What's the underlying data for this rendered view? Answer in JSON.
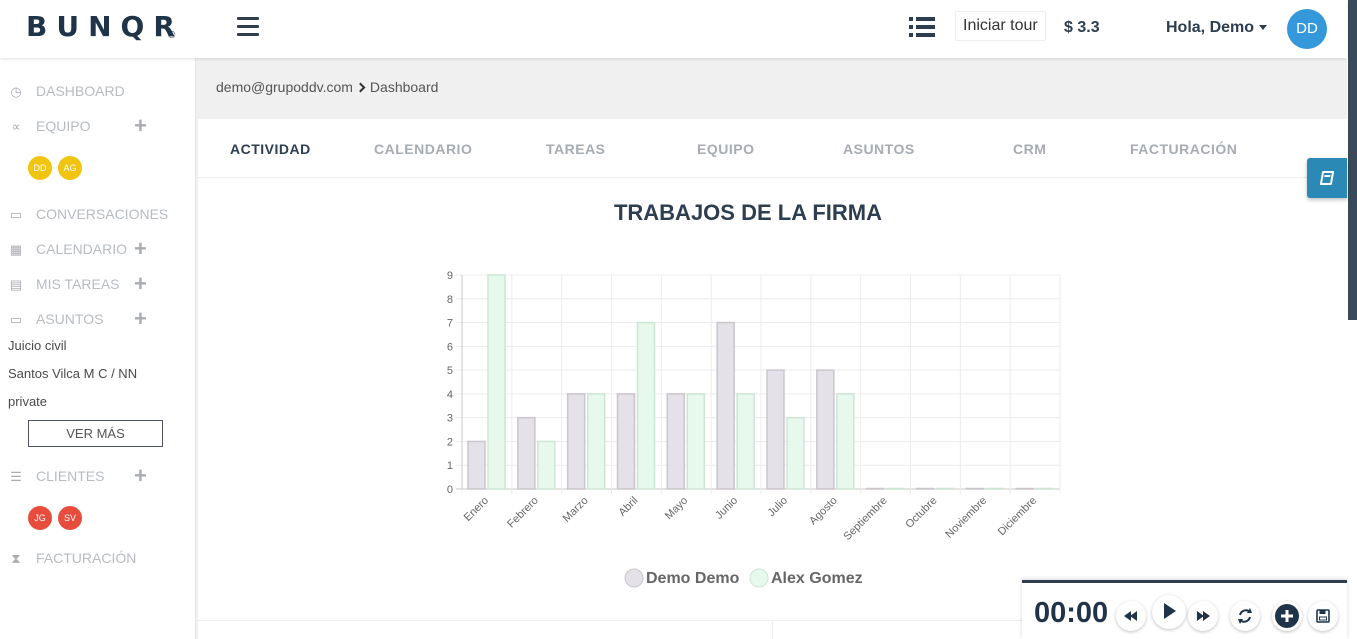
{
  "brand": {
    "name": "BUNQR",
    "registered": "®"
  },
  "topbar": {
    "tour_label": "Iniciar tour",
    "balance": "$ 3.3",
    "greeting": "Hola, Demo",
    "avatar_initials": "DD"
  },
  "sidebar": {
    "dashboard": "DASHBOARD",
    "equipo": "EQUIPO",
    "team_avatars": [
      "DD",
      "AG"
    ],
    "conversaciones": "CONVERSACIONES",
    "calendario": "CALENDARIO",
    "mis_tareas": "MIS TAREAS",
    "asuntos": "ASUNTOS",
    "asuntos_list": [
      "Juicio civil",
      "Santos Vilca M C / NN",
      "private"
    ],
    "ver_mas": "VER MÁS",
    "clientes": "CLIENTES",
    "client_avatars": [
      "JG",
      "SV"
    ],
    "facturacion": "FACTURACIÓN",
    "plus": "+"
  },
  "breadcrumb": {
    "account": "demo@grupoddv.com",
    "page": "Dashboard"
  },
  "tabs": [
    "ACTIVIDAD",
    "CALENDARIO",
    "TAREAS",
    "EQUIPO",
    "ASUNTOS",
    "CRM",
    "FACTURACIÓN"
  ],
  "active_tab": "ACTIVIDAD",
  "chart_data": {
    "type": "bar",
    "title": "TRABAJOS DE LA FIRMA",
    "categories": [
      "Enero",
      "Febrero",
      "Marzo",
      "Abril",
      "Mayo",
      "Junio",
      "Julio",
      "Agosto",
      "Septiembre",
      "Octubre",
      "Noviembre",
      "Diciembre"
    ],
    "series": [
      {
        "name": "Demo Demo",
        "values": [
          2,
          3,
          4,
          4,
          4,
          7,
          5,
          5,
          0,
          0,
          0,
          0
        ],
        "fill": "#e5e1e8",
        "stroke": "#cbc5cc"
      },
      {
        "name": "Alex Gomez",
        "values": [
          9,
          2,
          4,
          7,
          4,
          4,
          3,
          4,
          0,
          0,
          0,
          0
        ],
        "fill": "#e7f9ec",
        "stroke": "#cde5d4"
      }
    ],
    "ylim": [
      0,
      9
    ],
    "yticks": [
      0,
      1,
      2,
      3,
      4,
      5,
      6,
      7,
      8,
      9
    ],
    "grid": true,
    "legend": "bottom"
  },
  "timer": {
    "time": "00:00"
  },
  "icons": {
    "menu": "hamburger-icon",
    "list": "list-icon",
    "book": "book-icon"
  }
}
